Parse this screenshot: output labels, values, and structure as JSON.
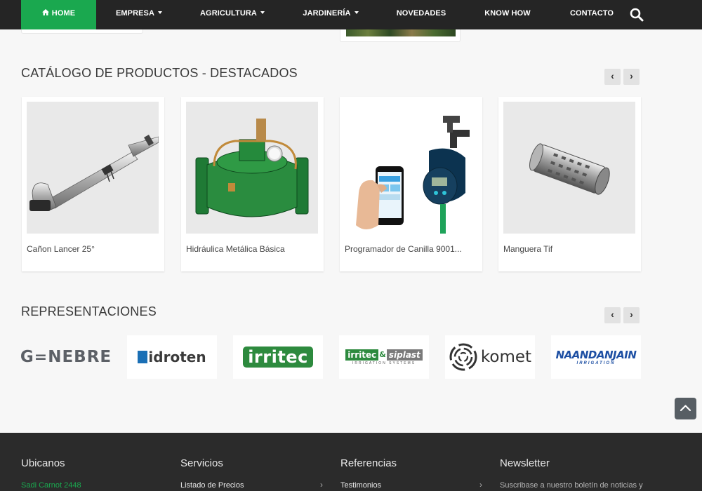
{
  "nav": {
    "items": [
      {
        "label": "HOME",
        "active": true,
        "dropdown": false
      },
      {
        "label": "EMPRESA",
        "dropdown": true
      },
      {
        "label": "AGRICULTURA",
        "dropdown": true
      },
      {
        "label": "JARDINERÍA",
        "dropdown": true
      },
      {
        "label": "NOVEDADES",
        "dropdown": false
      },
      {
        "label": "KNOW HOW",
        "dropdown": false
      },
      {
        "label": "CONTACTO",
        "dropdown": false
      }
    ],
    "search_icon": "search-icon",
    "home_icon": "house-icon",
    "active_color": "#1aa84f",
    "bar_color": "#252525"
  },
  "catalog": {
    "title": "CATÁLOGO DE PRODUCTOS - DESTACADOS",
    "prev_icon": "chevron-left-icon",
    "next_icon": "chevron-right-icon",
    "products": [
      {
        "name": "Cañon Lancer 25°"
      },
      {
        "name": "Hidráulica Metálica Básica"
      },
      {
        "name": "Programador de Canilla 9001..."
      },
      {
        "name": "Manguera Tif"
      }
    ]
  },
  "representaciones": {
    "title": "REPRESENTACIONES",
    "logos": [
      {
        "brand": "GENEBRE",
        "g_e": "G",
        "rest": "NEBRE"
      },
      {
        "brand": "hidroten",
        "text": "idroten"
      },
      {
        "brand": "irritec",
        "text": "irritec"
      },
      {
        "brand": "irritec & siplast",
        "left": "irritec",
        "amp": "&",
        "right": "siplast",
        "tagline": "IRRIGATION SYSTEMS"
      },
      {
        "brand": "komet",
        "text": "komet"
      },
      {
        "brand": "NAANDANJAIN",
        "text": "NAANDANJAIN",
        "tagline": "IRRIGATION"
      }
    ]
  },
  "footer": {
    "columns": [
      {
        "title": "Ubicanos",
        "line": "Sadi Carnot 2448",
        "line_color": "#1aa84f"
      },
      {
        "title": "Servicios",
        "line": "Listado de Precios"
      },
      {
        "title": "Referencias",
        "line": "Testimonios"
      },
      {
        "title": "Newsletter",
        "line": "Suscribase a nuestro boletín de noticias y"
      }
    ]
  }
}
